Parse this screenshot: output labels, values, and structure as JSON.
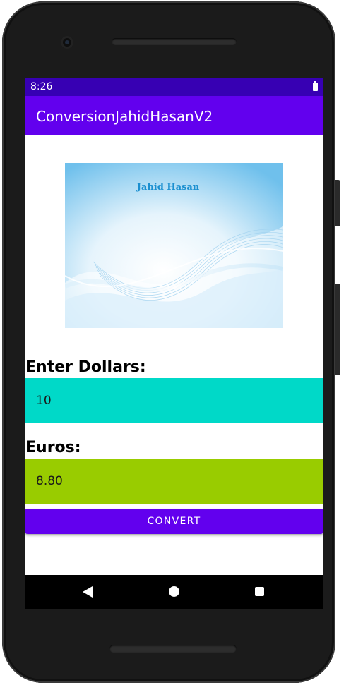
{
  "status_bar": {
    "time": "8:26",
    "battery_icon": "battery-full-icon"
  },
  "app_bar": {
    "title": "ConversionJahidHasanV2",
    "color": "#6200ee"
  },
  "hero_image": {
    "caption": "Jahid Hasan"
  },
  "dollars": {
    "label": "Enter Dollars:",
    "value": "10",
    "background": "#00d9c8"
  },
  "euros": {
    "label": "Euros:",
    "value": "8.80",
    "background": "#99cc00"
  },
  "convert_button": {
    "label": "CONVERT",
    "color": "#6200ee"
  },
  "nav_bar": {
    "back_icon": "back-triangle-icon",
    "home_icon": "home-circle-icon",
    "recents_icon": "recents-square-icon"
  }
}
